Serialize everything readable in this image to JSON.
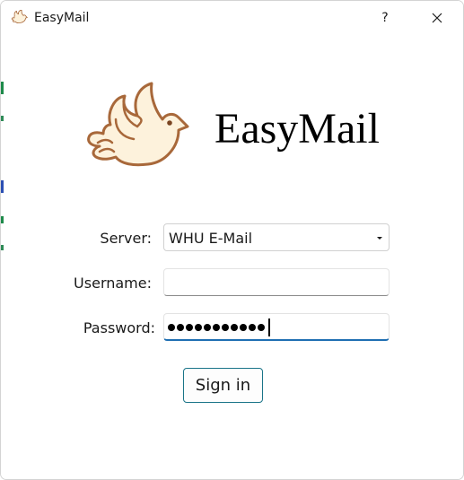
{
  "window": {
    "title": "EasyMail",
    "help_label": "?",
    "close_icon": "close-icon"
  },
  "logo": {
    "icon": "bird-icon",
    "text": "EasyMail",
    "bird_fill": "#fdf2dc",
    "bird_stroke": "#a8683a"
  },
  "form": {
    "server_label": "Server:",
    "server_value": "WHU E-Mail",
    "username_label": "Username:",
    "username_value": "",
    "password_label": "Password:",
    "password_length": 11,
    "focus_color": "#1f6fb2"
  },
  "actions": {
    "signin_label": "Sign in",
    "signin_border": "#1a7488"
  }
}
